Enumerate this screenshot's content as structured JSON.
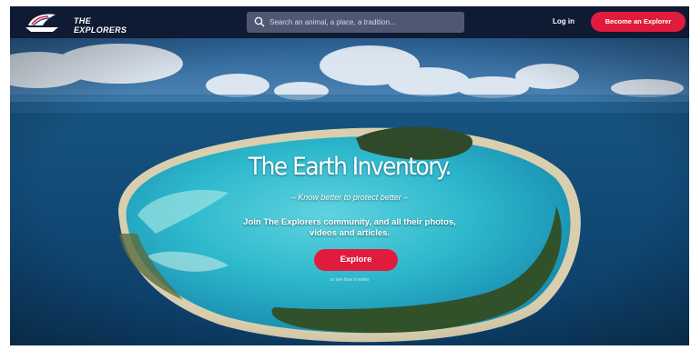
{
  "nav": {
    "logo_line1": "THE",
    "logo_line2": "EXPLORERS",
    "search_placeholder": "Search an animal, a place, a tradition...",
    "login_label": "Log in",
    "cta_label": "Become an Explorer"
  },
  "hero": {
    "title": "The Earth Inventory.",
    "tagline": "– Know better to protect better –",
    "description_line1": "Join The Explorers community, and all their photos,",
    "description_line2": "videos and articles.",
    "explore_label": "Explore",
    "how_it_works": "or see how it works"
  },
  "colors": {
    "nav_background": "#0f1a33",
    "accent": "#e11b3d",
    "search_background": "#4f5873"
  },
  "icons": [
    "logo-ship-icon",
    "search-icon"
  ]
}
